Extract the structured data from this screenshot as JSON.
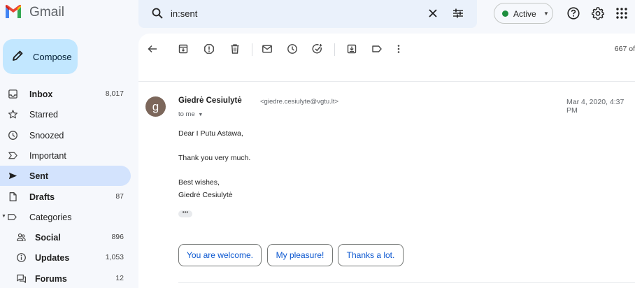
{
  "app": {
    "name": "Gmail"
  },
  "compose": {
    "label": "Compose"
  },
  "nav": {
    "inbox": {
      "label": "Inbox",
      "count": "8,017"
    },
    "starred": {
      "label": "Starred"
    },
    "snoozed": {
      "label": "Snoozed"
    },
    "important": {
      "label": "Important"
    },
    "sent": {
      "label": "Sent"
    },
    "drafts": {
      "label": "Drafts",
      "count": "87"
    },
    "categories": {
      "label": "Categories"
    },
    "social": {
      "label": "Social",
      "count": "896"
    },
    "updates": {
      "label": "Updates",
      "count": "1,053"
    },
    "forums": {
      "label": "Forums",
      "count": "12"
    }
  },
  "search": {
    "query": "in:sent"
  },
  "status": {
    "label": "Active",
    "color": "#1e8e3e"
  },
  "toolbar": {
    "pager": "667 of"
  },
  "email": {
    "avatar_letter": "g",
    "sender_name": "Giedrė Cesiulytė",
    "sender_email": "<giedre.cesiulyte@vgtu.lt>",
    "recipient": "to me",
    "date": "Mar 4, 2020, 4:37 PM",
    "body": {
      "greeting": "Dear I Putu Astawa,",
      "line1": "Thank you very much.",
      "closing": "Best wishes,",
      "signature": "Giedrė Cesiulytė"
    }
  },
  "smart_replies": [
    "You are welcome.",
    "My pleasure!",
    "Thanks a lot."
  ],
  "colors": {
    "compose_bg": "#c2e7ff",
    "active_nav_bg": "#d3e3fd",
    "accent": "#0b57d0",
    "avatar_bg": "#7c675b"
  }
}
